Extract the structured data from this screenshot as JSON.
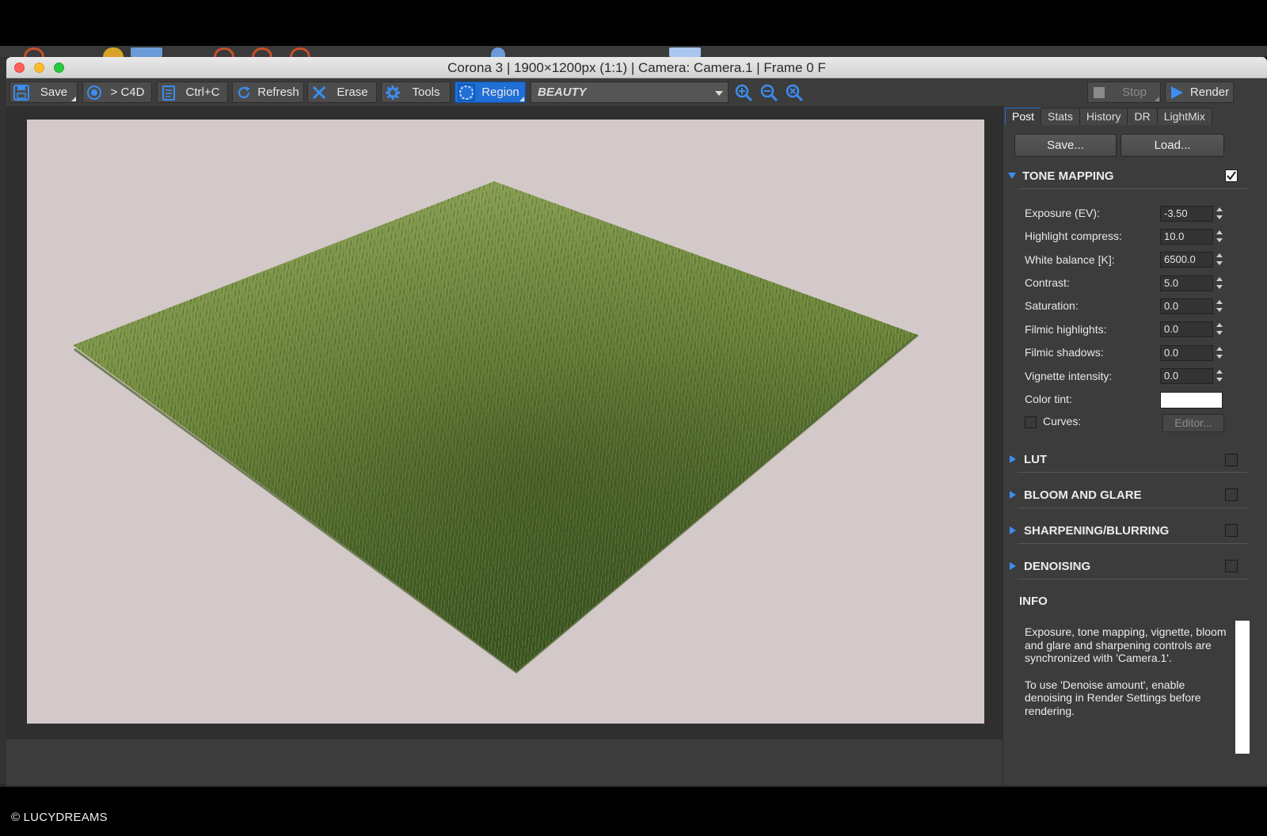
{
  "window": {
    "title": "Corona 3 | 1900×1200px (1:1) | Camera: Camera.1 | Frame 0 F"
  },
  "toolbar": {
    "save_label": "Save",
    "c4d_label": "> C4D",
    "copy_label": "Ctrl+C",
    "refresh_label": "Refresh",
    "erase_label": "Erase",
    "tools_label": "Tools",
    "region_label": "Region",
    "render_pass": "BEAUTY",
    "stop_label": "Stop",
    "render_label": "Render"
  },
  "panel": {
    "tabs": [
      "Post",
      "Stats",
      "History",
      "DR",
      "LightMix"
    ],
    "active_tab": "Post",
    "save_button": "Save...",
    "load_button": "Load...",
    "tone_mapping": {
      "title": "TONE MAPPING",
      "enabled": true,
      "fields": [
        {
          "label": "Exposure (EV):",
          "value": "-3.50"
        },
        {
          "label": "Highlight compress:",
          "value": "10.0"
        },
        {
          "label": "White balance [K]:",
          "value": "6500.0"
        },
        {
          "label": "Contrast:",
          "value": "5.0"
        },
        {
          "label": "Saturation:",
          "value": "0.0"
        },
        {
          "label": "Filmic highlights:",
          "value": "0.0"
        },
        {
          "label": "Filmic shadows:",
          "value": "0.0"
        },
        {
          "label": "Vignette intensity:",
          "value": "0.0"
        }
      ],
      "color_tint_label": "Color tint:",
      "color_tint_value": "#ffffff",
      "curves_label": "Curves:",
      "curves_enabled": false,
      "editor_button": "Editor..."
    },
    "sections": [
      {
        "title": "LUT",
        "enabled": false
      },
      {
        "title": "BLOOM AND GLARE",
        "enabled": false
      },
      {
        "title": "SHARPENING/BLURRING",
        "enabled": false
      },
      {
        "title": "DENOISING",
        "enabled": false
      }
    ],
    "info": {
      "title": "INFO",
      "paragraph1": "Exposure, tone mapping, vignette, bloom and glare and sharpening controls are synchronized with 'Camera.1'.",
      "paragraph2": "To use 'Denoise amount', enable denoising in Render Settings before rendering."
    }
  },
  "render": {
    "background_color": "#d3c9c9",
    "subject": "grass patch"
  },
  "colors": {
    "accent": "#1f6fd6",
    "panel_bg": "#3c3c3c",
    "section_arrow": "#3b8df0"
  },
  "watermark": "© LUCYDREAMS"
}
